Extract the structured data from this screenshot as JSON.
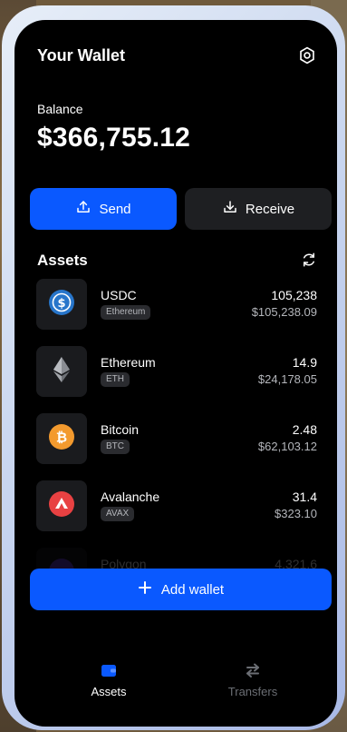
{
  "header": {
    "title": "Your Wallet",
    "settings_icon": "gear-icon"
  },
  "balance": {
    "label": "Balance",
    "value": "$366,755.12"
  },
  "actions": {
    "send_label": "Send",
    "receive_label": "Receive"
  },
  "assets": {
    "title": "Assets",
    "items": [
      {
        "name": "USDC",
        "network": "Ethereum",
        "amount": "105,238",
        "fiat": "$105,238.09",
        "icon": "usdc-icon",
        "color": "#2775ca"
      },
      {
        "name": "Ethereum",
        "network": "ETH",
        "amount": "14.9",
        "fiat": "$24,178.05",
        "icon": "ethereum-icon",
        "color": "#8a8d93"
      },
      {
        "name": "Bitcoin",
        "network": "BTC",
        "amount": "2.48",
        "fiat": "$62,103.12",
        "icon": "bitcoin-icon",
        "color": "#f39a2e"
      },
      {
        "name": "Avalanche",
        "network": "AVAX",
        "amount": "31.4",
        "fiat": "$323.10",
        "icon": "avalanche-icon",
        "color": "#e84142"
      },
      {
        "name": "Polygon",
        "network": "",
        "amount": "4,321.6",
        "fiat": "",
        "icon": "polygon-icon",
        "color": "#6c3de0"
      }
    ]
  },
  "add_wallet": {
    "label": "Add wallet"
  },
  "nav": {
    "items": [
      {
        "label": "Assets",
        "icon": "wallet-icon",
        "active": true
      },
      {
        "label": "Transfers",
        "icon": "transfer-icon",
        "active": false
      }
    ]
  },
  "colors": {
    "accent": "#0a59ff",
    "background": "#000000",
    "card": "#1a1b1e"
  }
}
